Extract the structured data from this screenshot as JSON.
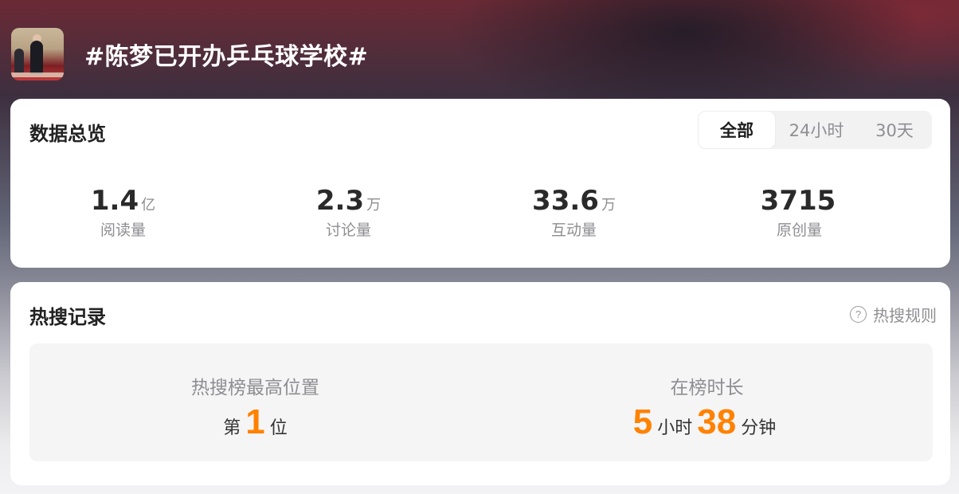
{
  "header": {
    "title": "#陈梦已开办乒乓球学校#",
    "avatar_icon": "photo-avatar"
  },
  "overview": {
    "title": "数据总览",
    "tabs": [
      {
        "label": "全部",
        "selected": true
      },
      {
        "label": "24小时",
        "selected": false
      },
      {
        "label": "30天",
        "selected": false
      }
    ],
    "stats": [
      {
        "value": "1.4",
        "unit": "亿",
        "label": "阅读量"
      },
      {
        "value": "2.3",
        "unit": "万",
        "label": "讨论量"
      },
      {
        "value": "33.6",
        "unit": "万",
        "label": "互动量"
      },
      {
        "value": "3715",
        "unit": "",
        "label": "原创量"
      }
    ]
  },
  "records": {
    "title": "热搜记录",
    "rules_label": "热搜规则",
    "rules_icon": "question-circle-icon",
    "highest": {
      "label": "热搜榜最高位置",
      "prefix": "第",
      "value": "1",
      "suffix": "位"
    },
    "duration": {
      "label": "在榜时长",
      "hours": "5",
      "hours_unit": "小时",
      "minutes": "38",
      "minutes_unit": "分钟"
    }
  },
  "colors": {
    "accent": "#ff8200",
    "card": "#ffffff"
  }
}
